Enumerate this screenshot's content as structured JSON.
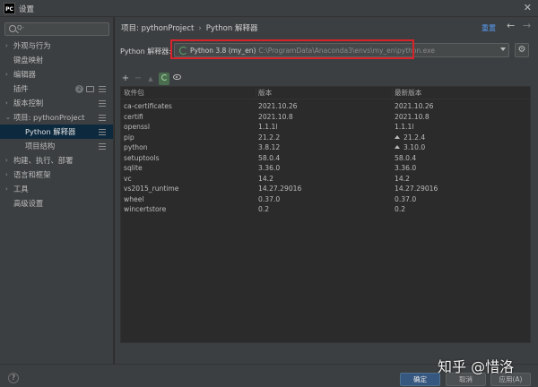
{
  "window": {
    "title": "设置",
    "app_icon_text": "PC"
  },
  "sidebar": {
    "search_caret": "Q-",
    "items": [
      {
        "label": "外观与行为",
        "arrow": "›"
      },
      {
        "label": "键盘映射",
        "arrow": ""
      },
      {
        "label": "编辑器",
        "arrow": "›"
      },
      {
        "label": "插件",
        "arrow": "",
        "badge": "2"
      },
      {
        "label": "版本控制",
        "arrow": "›"
      },
      {
        "label": "项目: pythonProject",
        "arrow": "⌄"
      },
      {
        "label": "Python 解释器",
        "arrow": ""
      },
      {
        "label": "项目结构",
        "arrow": ""
      },
      {
        "label": "构建、执行、部署",
        "arrow": "›"
      },
      {
        "label": "语言和框架",
        "arrow": "›"
      },
      {
        "label": "工具",
        "arrow": "›"
      },
      {
        "label": "高级设置",
        "arrow": ""
      }
    ]
  },
  "header": {
    "breadcrumb_project": "项目: pythonProject",
    "breadcrumb_sep": "›",
    "breadcrumb_page": "Python 解释器",
    "reset_label": "重置",
    "back_icon": "←",
    "forward_icon": "→"
  },
  "interpreter": {
    "label": "Python 解释器:",
    "name": "Python 3.8 (my_en)",
    "path": "C:\\ProgramData\\Anaconda3\\envs\\my_en\\python.exe"
  },
  "toolbar": {
    "add": "+",
    "remove": "−",
    "upgrade": "▲"
  },
  "table": {
    "headers": [
      "软件包",
      "版本",
      "最新版本"
    ],
    "rows": [
      [
        "ca-certificates",
        "2021.10.26",
        "2021.10.26"
      ],
      [
        "certifi",
        "2021.10.8",
        "2021.10.8"
      ],
      [
        "openssl",
        "1.1.1l",
        "1.1.1l"
      ],
      [
        "pip",
        "21.2.2",
        "21.2.4"
      ],
      [
        "python",
        "3.8.12",
        "3.10.0"
      ],
      [
        "setuptools",
        "58.0.4",
        "58.0.4"
      ],
      [
        "sqlite",
        "3.36.0",
        "3.36.0"
      ],
      [
        "vc",
        "14.2",
        "14.2"
      ],
      [
        "vs2015_runtime",
        "14.27.29016",
        "14.27.29016"
      ],
      [
        "wheel",
        "0.37.0",
        "0.37.0"
      ],
      [
        "wincertstore",
        "0.2",
        "0.2"
      ]
    ],
    "upgrade_rows": [
      3,
      4
    ]
  },
  "footer": {
    "help": "?",
    "ok": "确定",
    "cancel": "取消",
    "apply": "应用(A)"
  },
  "watermark": "知乎 @惜洛",
  "colors": {
    "accent": "#365880",
    "highlight": "#d9232a",
    "link": "#589df6",
    "selected": "#0d293e"
  }
}
